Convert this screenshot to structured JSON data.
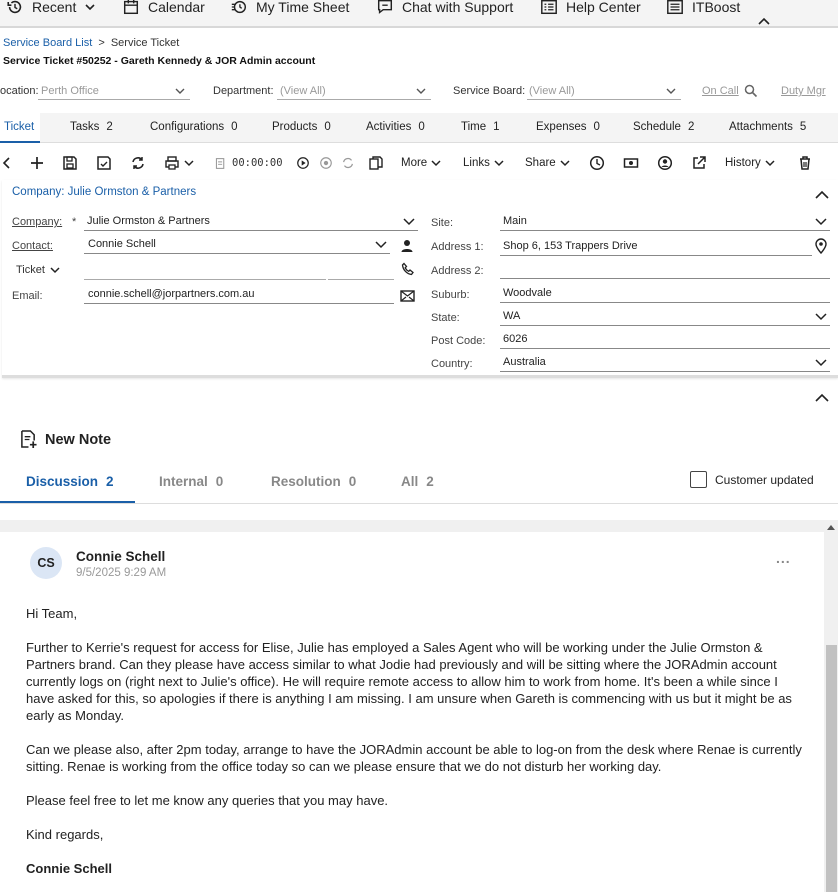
{
  "topnav": {
    "items": [
      {
        "label": "Recent",
        "icon": "history-icon"
      },
      {
        "label": "Calendar",
        "icon": "calendar-icon"
      },
      {
        "label": "My Time Sheet",
        "icon": "timesheet-icon"
      },
      {
        "label": "Chat with Support",
        "icon": "chat-icon"
      },
      {
        "label": "Help Center",
        "icon": "help-list-icon"
      },
      {
        "label": "ITBoost",
        "icon": "list-icon"
      }
    ]
  },
  "breadcrumb": {
    "link": "Service Board List",
    "sep": ">",
    "current": "Service Ticket"
  },
  "ticket_title": "Service Ticket #50252 - Gareth Kennedy & JOR Admin account",
  "filters": {
    "location_label": "ocation:",
    "location_value": "Perth Office",
    "department_label": "Department:",
    "department_value": "(View All)",
    "board_label": "Service Board:",
    "board_value": "(View All)",
    "on_call": "On Call",
    "duty_mgr": "Duty Mgr"
  },
  "tabs": [
    {
      "label": "Ticket",
      "count": ""
    },
    {
      "label": "Tasks",
      "count": "2"
    },
    {
      "label": "Configurations",
      "count": "0"
    },
    {
      "label": "Products",
      "count": "0"
    },
    {
      "label": "Activities",
      "count": "0"
    },
    {
      "label": "Time",
      "count": "1"
    },
    {
      "label": "Expenses",
      "count": "0"
    },
    {
      "label": "Schedule",
      "count": "2"
    },
    {
      "label": "Attachments",
      "count": "5"
    }
  ],
  "toolbar": {
    "timer": "00:00:00",
    "more": "More",
    "links": "Links",
    "share": "Share",
    "history": "History"
  },
  "company_panel": {
    "header": "Company: Julie Ormston & Partners",
    "company_label": "Company:",
    "required": "*",
    "company_value": "Julie Ormston & Partners",
    "contact_label": "Contact:",
    "contact_value": "Connie Schell",
    "ticket_label": "Ticket",
    "email_label": "Email:",
    "email_value": "connie.schell@jorpartners.com.au",
    "site_label": "Site:",
    "site_value": "Main",
    "address1_label": "Address 1:",
    "address1_value": "Shop 6, 153 Trappers Drive",
    "address2_label": "Address 2:",
    "address2_value": "",
    "suburb_label": "Suburb:",
    "suburb_value": "Woodvale",
    "state_label": "State:",
    "state_value": "WA",
    "postcode_label": "Post Code:",
    "postcode_value": "6026",
    "country_label": "Country:",
    "country_value": "Australia"
  },
  "notes": {
    "new_note": "New Note",
    "tabs": [
      {
        "label": "Discussion",
        "count": "2"
      },
      {
        "label": "Internal",
        "count": "0"
      },
      {
        "label": "Resolution",
        "count": "0"
      },
      {
        "label": "All",
        "count": "2"
      }
    ],
    "customer_updated": "Customer updated",
    "message": {
      "initials": "CS",
      "author": "Connie Schell",
      "timestamp": "9/5/2025 9:29 AM",
      "menu": "...",
      "greeting": "Hi Team,",
      "para1": "Further to Kerrie's request for access for Elise, Julie has employed a Sales Agent who will be working under the Julie Ormston & Partners brand. Can they please have access similar to what Jodie had previously and will be sitting where the JORAdmin account currently logs on (right next to Julie's office). He will require remote access to allow him to work from home. It's been a while since I have asked for this, so apologies if there is anything I am missing. I am unsure when Gareth is commencing with us but it might be as early as Monday.",
      "para2": "Can we please also, after 2pm today, arrange to have the JORAdmin account be able to log-on from the desk where Renae is currently sitting. Renae is working from the office today so can we please ensure that we do not disturb her working day.",
      "para3": "Please feel free to let me know any queries that you may have.",
      "signoff": "Kind regards,",
      "signature": "Connie Schell"
    }
  },
  "colors": {
    "link": "#1a5fa8",
    "bar": "#f4f4f4"
  }
}
